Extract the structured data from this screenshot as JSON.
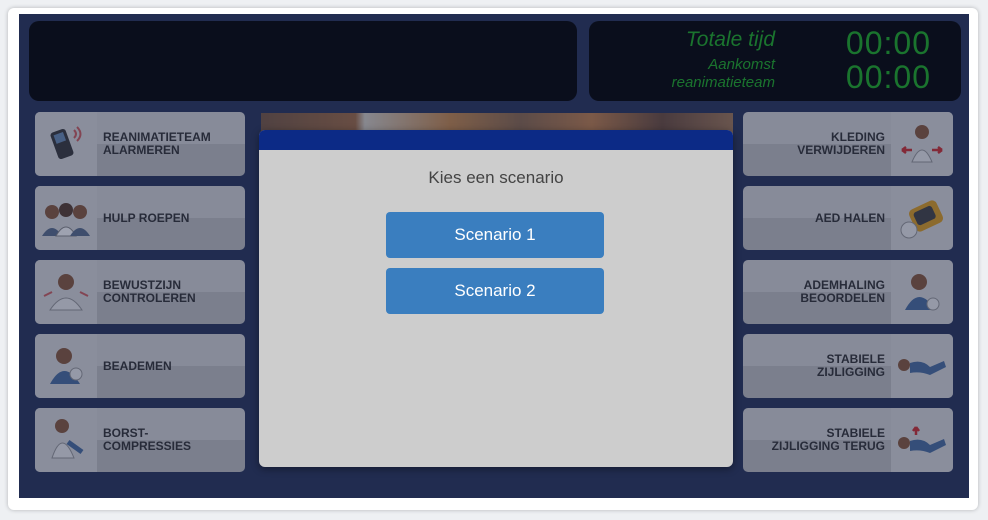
{
  "timer": {
    "total_label": "Totale tijd",
    "arrival_label_line1": "Aankomst",
    "arrival_label_line2": "reanimatieteam",
    "total_time": "00:00",
    "arrival_time": "00:00",
    "color": "#1db020"
  },
  "left_actions": [
    {
      "line1": "REANIMATIETEAM",
      "line2": "ALARMEREN",
      "icon": "phone-icon"
    },
    {
      "line1": "HULP ROEPEN",
      "line2": "",
      "icon": "group-icon"
    },
    {
      "line1": "BEWUSTZIJN",
      "line2": "CONTROLEREN",
      "icon": "shake-person-icon"
    },
    {
      "line1": "BEADEMEN",
      "line2": "",
      "icon": "breathing-icon"
    },
    {
      "line1": "BORST-",
      "line2": "COMPRESSIES",
      "icon": "compression-icon"
    }
  ],
  "right_actions": [
    {
      "line1": "KLEDING",
      "line2": "VERWIJDEREN",
      "icon": "clothing-icon"
    },
    {
      "line1": "AED HALEN",
      "line2": "",
      "icon": "aed-icon"
    },
    {
      "line1": "ADEMHALING",
      "line2": "BEOORDELEN",
      "icon": "check-breathing-icon"
    },
    {
      "line1": "STABIELE",
      "line2": "ZIJLIGGING",
      "icon": "recovery-position-icon"
    },
    {
      "line1": "STABIELE",
      "line2": "ZIJLIGGING TERUG",
      "icon": "recovery-return-icon"
    }
  ],
  "modal": {
    "title": "Kies een scenario",
    "scenario1": "Scenario 1",
    "scenario2": "Scenario 2",
    "header_color": "#0c2a86",
    "button_color": "#3a7ebf"
  }
}
